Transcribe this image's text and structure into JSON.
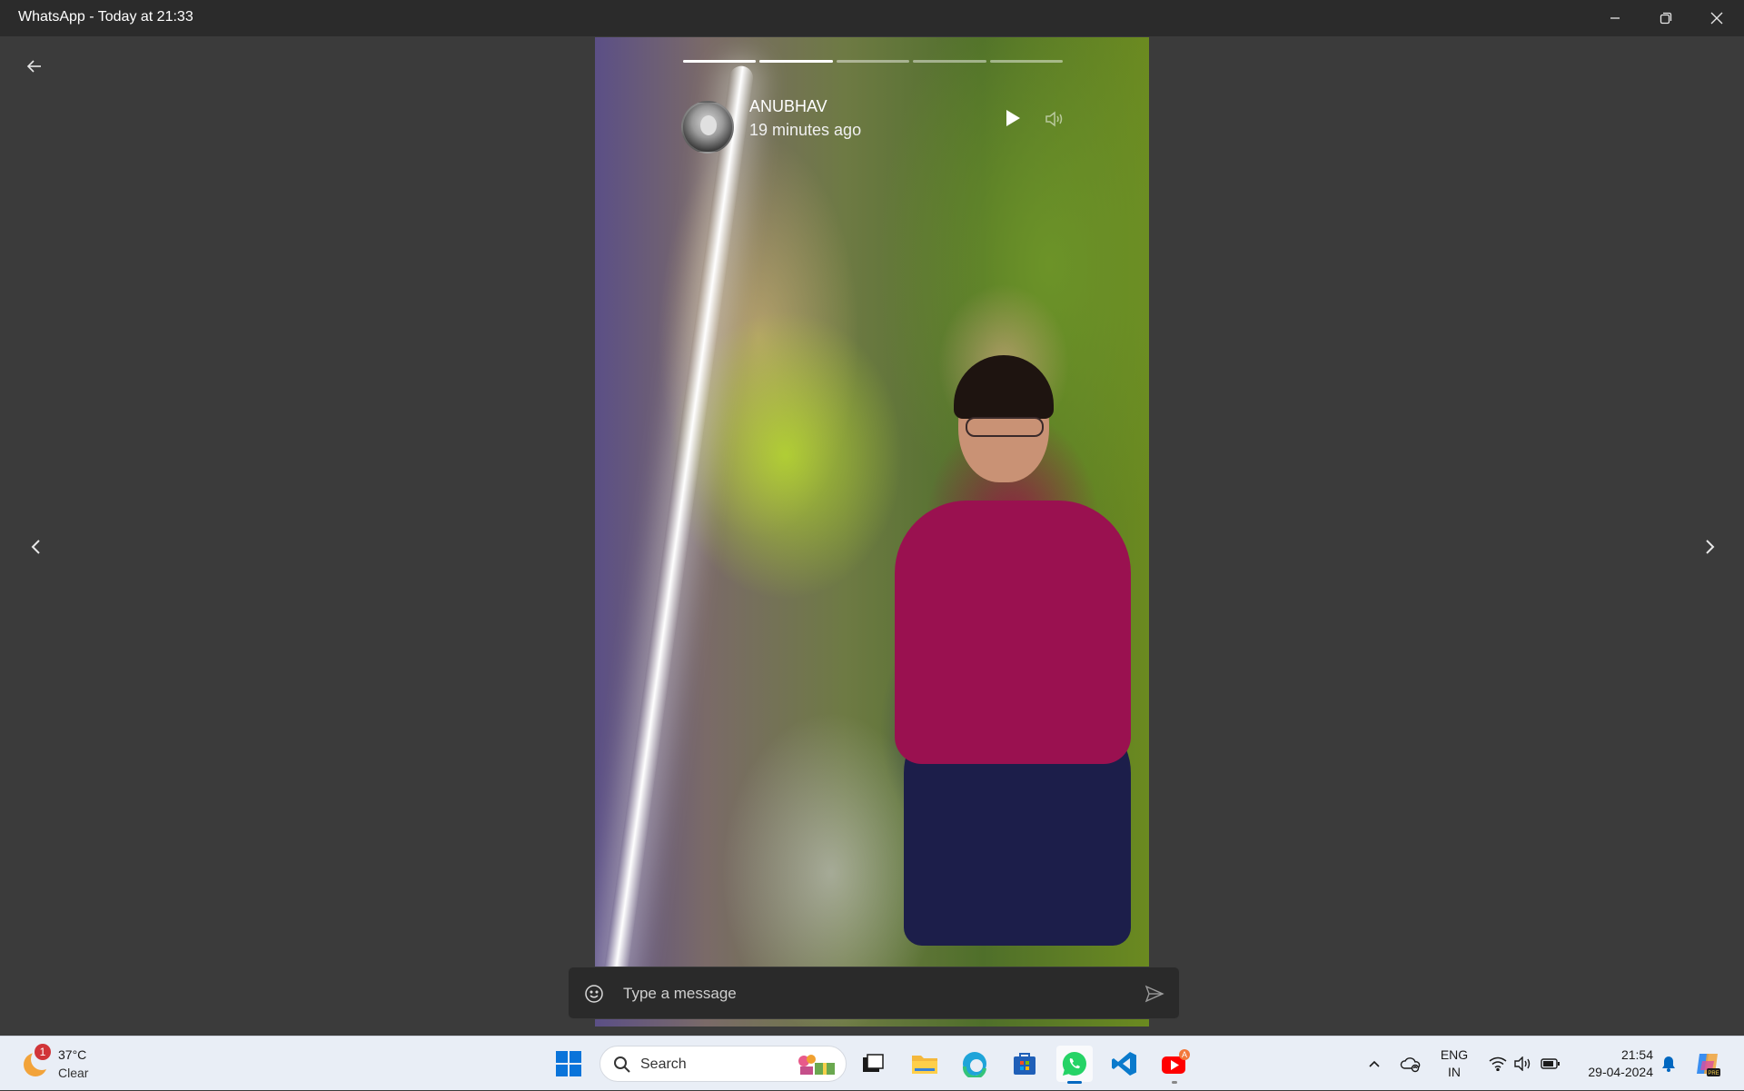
{
  "window": {
    "title": "WhatsApp - Today at 21:33"
  },
  "status": {
    "progress_segments": [
      1,
      1,
      0,
      0,
      0
    ],
    "sender_name": "ANUBHAV",
    "time_ago": "19 minutes ago"
  },
  "message": {
    "placeholder": "Type a message"
  },
  "taskbar": {
    "weather_badge": "1",
    "temperature": "37°C",
    "condition": "Clear",
    "search_label": "Search",
    "youtube_badge": "A",
    "language_top": "ENG",
    "language_bottom": "IN",
    "time": "21:54",
    "date": "29-04-2024"
  },
  "colors": {
    "titlebar": "#2b2b2b",
    "viewer_bg": "#3b3b3b",
    "taskbar_bg": "#e9eef6",
    "whatsapp_green": "#25d366",
    "accent_blue": "#0067c0"
  }
}
